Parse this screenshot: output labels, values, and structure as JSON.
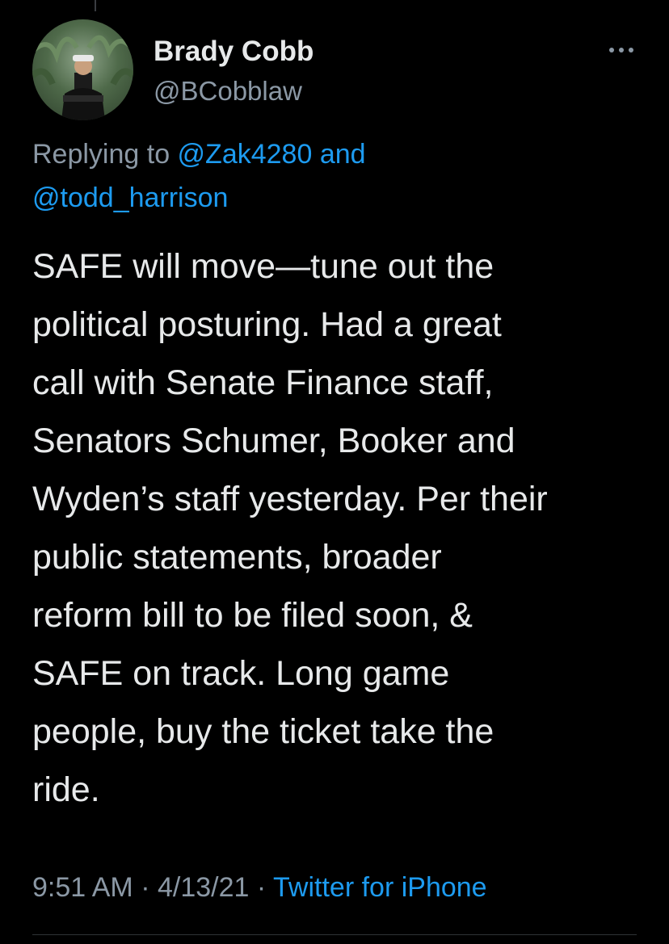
{
  "tweet": {
    "author": {
      "name": "Brady Cobb",
      "handle": "@BCobblaw"
    },
    "reply": {
      "prefix": "Replying to ",
      "mention1": "@Zak4280",
      "conjunction": " and",
      "mention2": "@todd_harrison"
    },
    "body_lines": [
      "SAFE will move—tune out the",
      "political posturing. Had a great",
      "call with Senate Finance staff,",
      "Senators Schumer, Booker and",
      "Wyden’s staff yesterday. Per their",
      "public statements, broader",
      "reform bill to be filed soon, &",
      "SAFE on track. Long game",
      "people, buy the ticket take the",
      "ride."
    ],
    "meta": {
      "time": "9:51 AM",
      "separator1": " · ",
      "date": "4/13/21",
      "separator2": " · ",
      "source": "Twitter for iPhone"
    },
    "icons": {
      "more": "more-horizontal-icon",
      "avatar": "profile-photo"
    },
    "colors": {
      "background": "#000000",
      "text": "#e7e9ea",
      "secondary": "#8b98a5",
      "accent": "#1d9bf0"
    }
  }
}
